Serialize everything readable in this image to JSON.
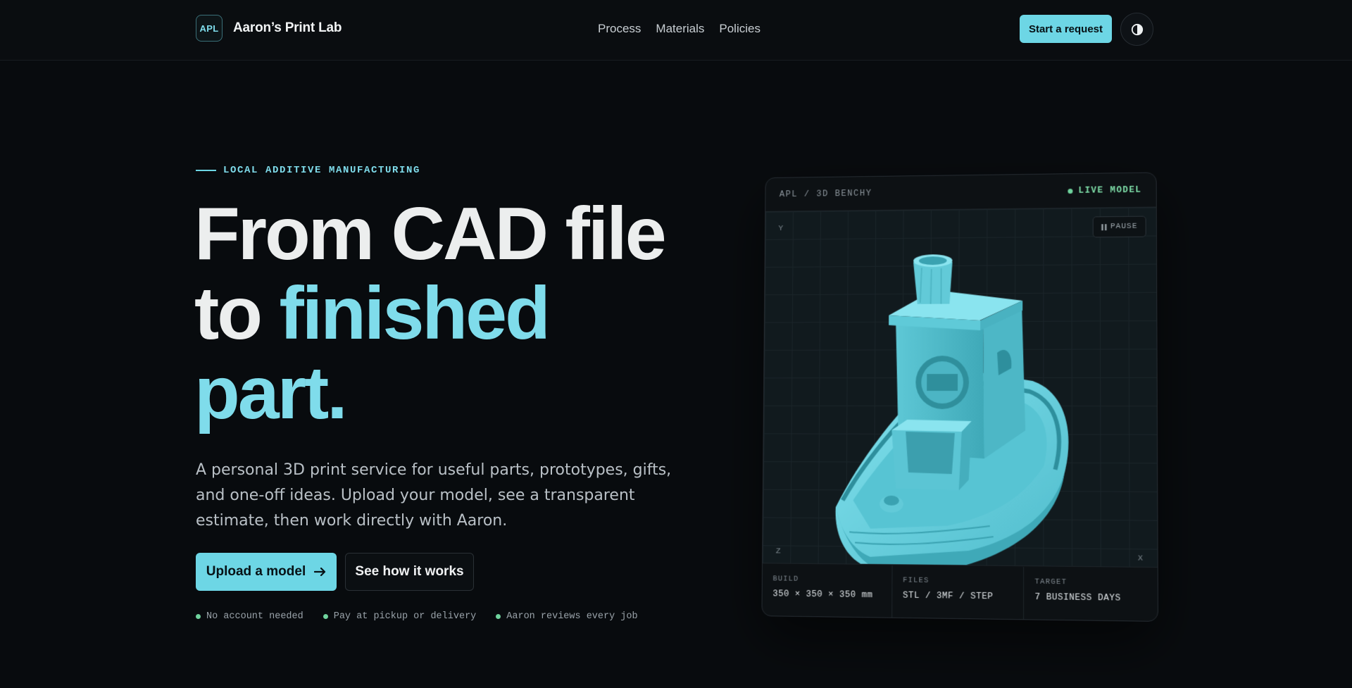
{
  "nav": {
    "brand_badge": "APL",
    "brand_name": "Aaron’s Print Lab",
    "links": [
      "Process",
      "Materials",
      "Policies"
    ],
    "cta": "Start a request",
    "theme_icon": "contrast-icon"
  },
  "hero": {
    "eyebrow": "LOCAL ADDITIVE MANUFACTURING",
    "headline_line1": "From CAD file",
    "headline_line2_plain": "to ",
    "headline_line2_accent": "finished",
    "headline_line3_accent": "part.",
    "lead": "A personal 3D print service for useful parts, prototypes, gifts, and one-off ideas. Upload your model, see a transparent estimate, then work directly with Aaron.",
    "primary_button": "Upload a model",
    "primary_button_icon": "arrow-right-icon",
    "secondary_button": "See how it works",
    "perks": [
      "No account needed",
      "Pay at pickup or delivery",
      "Aaron reviews every job"
    ]
  },
  "model_card": {
    "title": "APL / 3D BENCHY",
    "status": "LIVE MODEL",
    "pause_label": "PAUSE",
    "axes": {
      "y": "Y",
      "z": "Z",
      "x": "X"
    },
    "stats": [
      {
        "label": "BUILD",
        "value": "350 × 350 × 350 mm"
      },
      {
        "label": "FILES",
        "value": "STL / 3MF / STEP"
      },
      {
        "label": "TARGET",
        "value": "7 BUSINESS DAYS"
      }
    ]
  },
  "colors": {
    "accent": "#6dd6e5",
    "accent_text": "#7fdceb",
    "status_green": "#6fd39d",
    "background": "#080b0e"
  }
}
